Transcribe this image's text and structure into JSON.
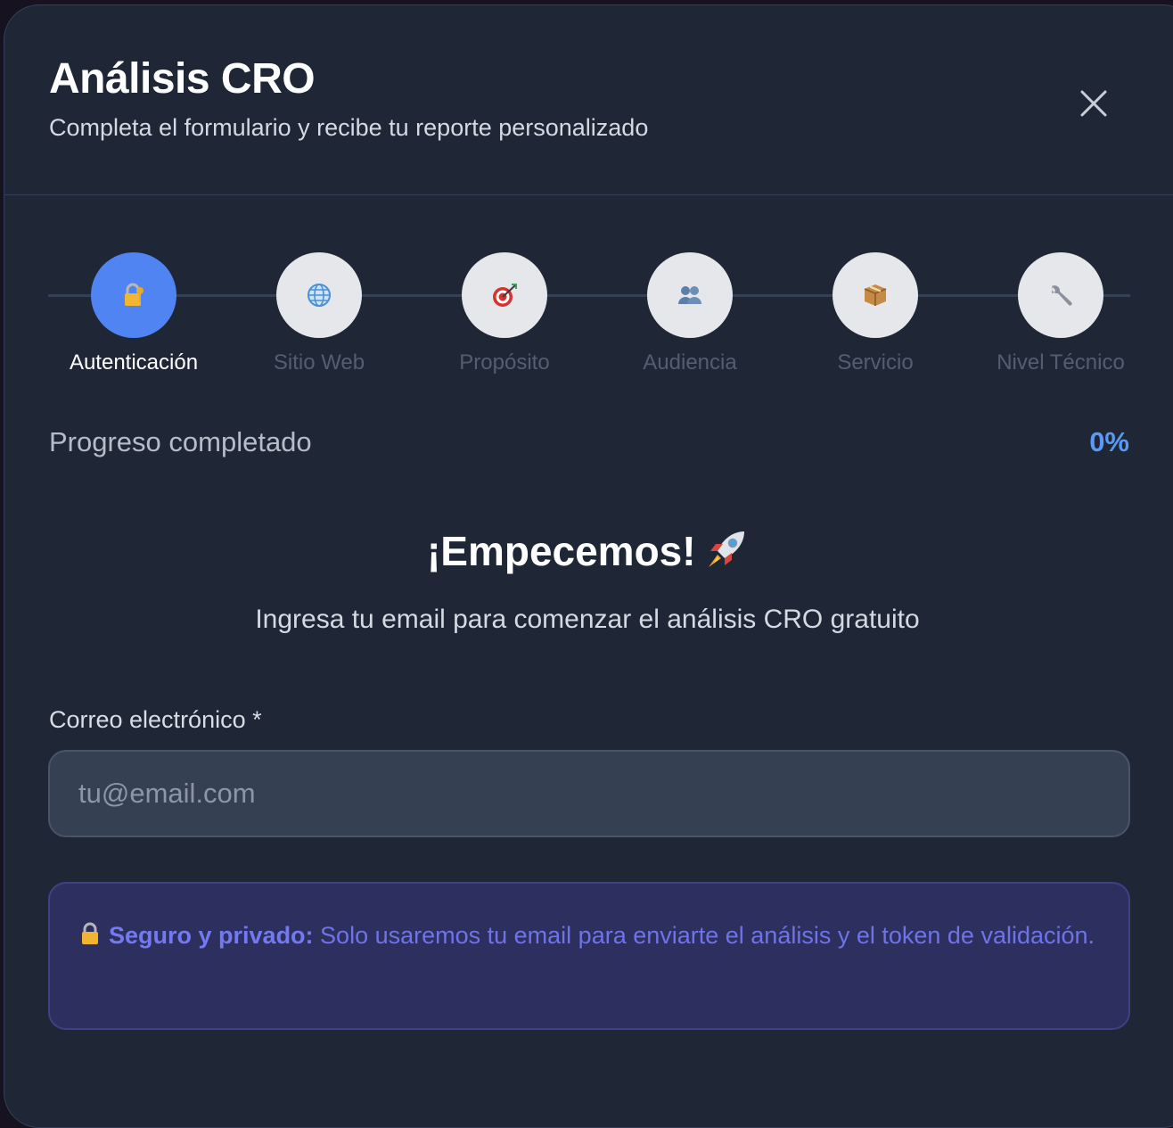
{
  "modal": {
    "title": "Análisis CRO",
    "subtitle": "Completa el formulario y recibe tu reporte personalizado",
    "close_icon": "close-icon"
  },
  "steps": [
    {
      "label": "Autenticación",
      "icon": "lock-key-icon",
      "active": true
    },
    {
      "label": "Sitio Web",
      "icon": "globe-icon",
      "active": false
    },
    {
      "label": "Propósito",
      "icon": "target-icon",
      "active": false
    },
    {
      "label": "Audiencia",
      "icon": "people-icon",
      "active": false
    },
    {
      "label": "Servicio",
      "icon": "package-icon",
      "active": false
    },
    {
      "label": "Nivel Técnico",
      "icon": "wrench-icon",
      "active": false
    }
  ],
  "progress": {
    "label": "Progreso completado",
    "value_text": "0%",
    "value": 0
  },
  "welcome": {
    "title": "¡Empecemos!",
    "icon": "rocket-icon",
    "subtitle": "Ingresa tu email para comenzar el análisis CRO gratuito"
  },
  "email_field": {
    "label": "Correo electrónico *",
    "placeholder": "tu@email.com",
    "value": ""
  },
  "privacy_notice": {
    "icon": "lock-icon",
    "bold": "Seguro y privado:",
    "text": " Solo usaremos tu email para enviarte el análisis y el token de validación."
  },
  "colors": {
    "background": "#1f2636",
    "accent": "#4f84f2",
    "progress_value": "#5b9af4",
    "notice_bg": "#2d305e",
    "notice_text": "#6f73e8"
  }
}
